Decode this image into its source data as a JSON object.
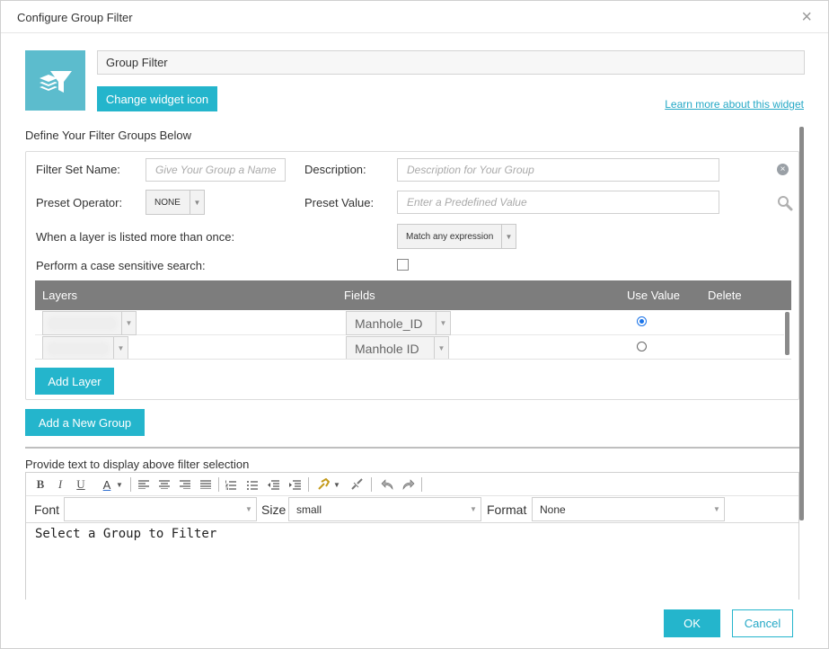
{
  "dialog": {
    "title": "Configure Group Filter",
    "close_glyph": "×"
  },
  "header": {
    "widget_name_value": "Group Filter",
    "change_icon_label": "Change widget icon",
    "learn_more_label": "Learn more about this widget"
  },
  "groups": {
    "section_label": "Define Your Filter Groups Below",
    "filter_set_name_label": "Filter Set Name:",
    "filter_set_name_placeholder": "Give Your Group a Name",
    "description_label": "Description:",
    "description_placeholder": "Description for Your Group",
    "preset_operator_label": "Preset Operator:",
    "preset_operator_value": "NONE",
    "preset_value_label": "Preset Value:",
    "preset_value_placeholder": "Enter a Predefined Value",
    "multi_layer_label": "When a layer is listed more than once:",
    "multi_layer_value": "Match any expression",
    "case_sensitive_label": "Perform a case sensitive search:",
    "case_sensitive_checked": false,
    "table": {
      "columns": [
        "Layers",
        "Fields",
        "Use Value",
        "Delete"
      ],
      "rows": [
        {
          "layer": "",
          "field": "Manhole_ID",
          "use_value": true
        },
        {
          "layer": "",
          "field": "Manhole ID",
          "use_value": false
        }
      ]
    },
    "add_layer_label": "Add Layer",
    "add_group_label": "Add a New Group"
  },
  "editor": {
    "section_label": "Provide text to display above filter selection",
    "toolbar": {
      "bold": "B",
      "italic": "I",
      "underline": "U",
      "font_color": "A"
    },
    "font_label": "Font",
    "font_value": "",
    "size_label": "Size",
    "size_value": "small",
    "format_label": "Format",
    "format_value": "None",
    "content": "Select a Group to Filter"
  },
  "footer": {
    "ok_label": "OK",
    "cancel_label": "Cancel"
  },
  "colors": {
    "accent": "#24b5cc",
    "table_header": "#7d7d7d",
    "icon_tile": "#5cbccd"
  }
}
